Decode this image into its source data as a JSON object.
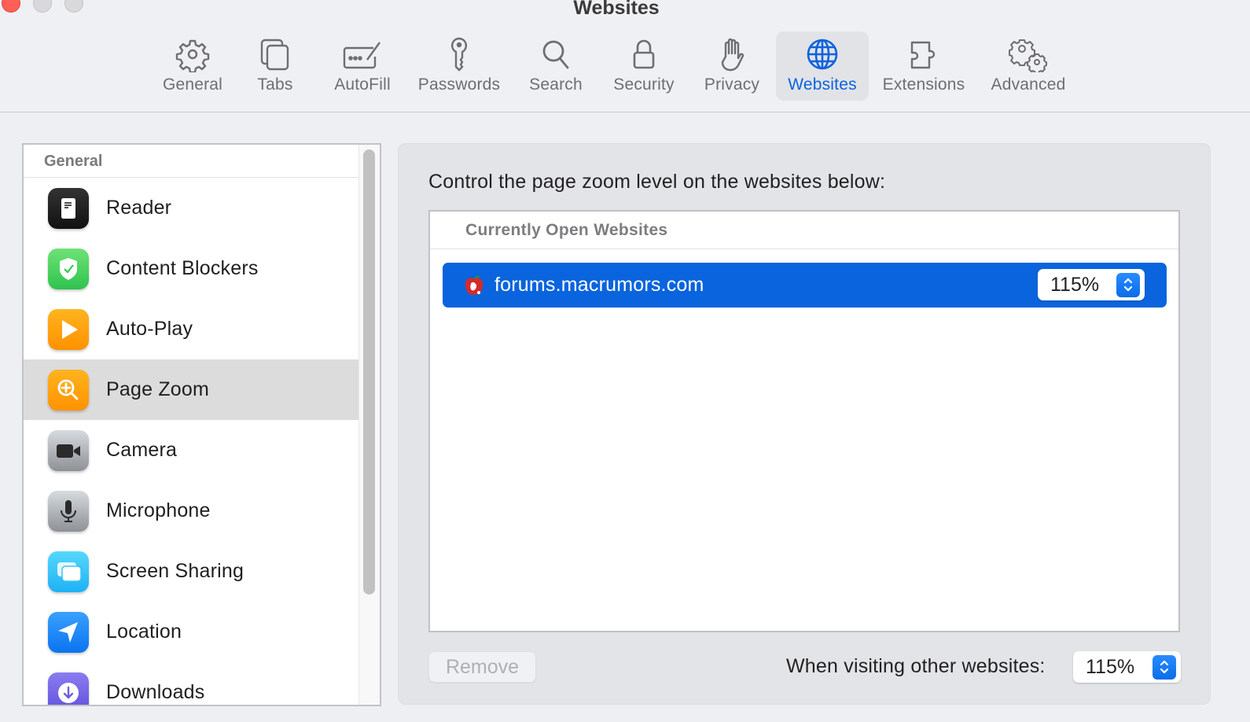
{
  "window": {
    "title": "Websites",
    "traffic_lights": [
      "close",
      "minimize",
      "zoom"
    ]
  },
  "toolbar": {
    "items": [
      {
        "label": "General",
        "icon": "gear-icon",
        "active": false
      },
      {
        "label": "Tabs",
        "icon": "tabs-icon",
        "active": false
      },
      {
        "label": "AutoFill",
        "icon": "autofill-icon",
        "active": false
      },
      {
        "label": "Passwords",
        "icon": "key-icon",
        "active": false
      },
      {
        "label": "Search",
        "icon": "search-icon",
        "active": false
      },
      {
        "label": "Security",
        "icon": "lock-icon",
        "active": false
      },
      {
        "label": "Privacy",
        "icon": "hand-icon",
        "active": false
      },
      {
        "label": "Websites",
        "icon": "globe-icon",
        "active": true
      },
      {
        "label": "Extensions",
        "icon": "puzzle-icon",
        "active": false
      },
      {
        "label": "Advanced",
        "icon": "gears-icon",
        "active": false
      }
    ],
    "accent_color": "#0a63de"
  },
  "sidebar": {
    "section_header": "General",
    "items": [
      {
        "label": "Reader",
        "icon": "reader-icon",
        "color": "#1c1c1e",
        "selected": false
      },
      {
        "label": "Content Blockers",
        "icon": "shield-check-icon",
        "color": "#34c759",
        "selected": false
      },
      {
        "label": "Auto-Play",
        "icon": "play-icon",
        "color": "#ff9500",
        "selected": false
      },
      {
        "label": "Page Zoom",
        "icon": "zoom-in-icon",
        "color": "#ff9500",
        "selected": true
      },
      {
        "label": "Camera",
        "icon": "video-camera-icon",
        "color": "#a8acb2",
        "selected": false
      },
      {
        "label": "Microphone",
        "icon": "microphone-icon",
        "color": "#a8acb2",
        "selected": false
      },
      {
        "label": "Screen Sharing",
        "icon": "screen-sharing-icon",
        "color": "#35c3f7",
        "selected": false
      },
      {
        "label": "Location",
        "icon": "location-arrow-icon",
        "color": "#1a86f7",
        "selected": false
      },
      {
        "label": "Downloads",
        "icon": "download-icon",
        "color": "#6a5ee0",
        "selected": false
      }
    ]
  },
  "content": {
    "description": "Control the page zoom level on the websites below:",
    "table": {
      "header": "Currently Open Websites",
      "rows": [
        {
          "site": "forums.macrumors.com",
          "zoom": "115%",
          "selected": true
        }
      ]
    },
    "remove_button": "Remove",
    "other_websites_label": "When visiting other websites:",
    "other_websites_zoom": "115%"
  }
}
